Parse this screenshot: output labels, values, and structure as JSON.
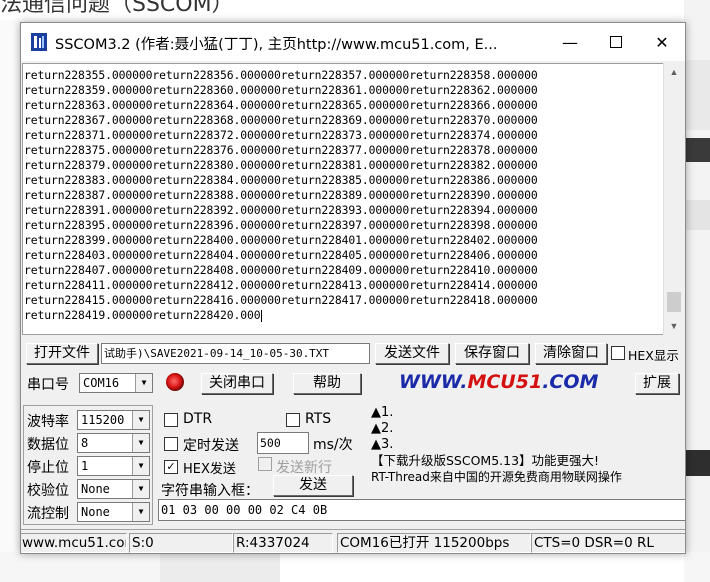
{
  "background": {
    "heading": "法通信问题（SSCOM）"
  },
  "window": {
    "title": "SSCOM3.2 (作者:聂小猛(丁丁), 主页http://www.mcu51.com,  E...",
    "minimize_icon": "minimize-icon",
    "maximize_icon": "maximize-icon",
    "close_icon": "close-icon"
  },
  "receive_area": {
    "lines": [
      "return228355.000000return228356.000000return228357.000000return228358.000000",
      "return228359.000000return228360.000000return228361.000000return228362.000000",
      "return228363.000000return228364.000000return228365.000000return228366.000000",
      "return228367.000000return228368.000000return228369.000000return228370.000000",
      "return228371.000000return228372.000000return228373.000000return228374.000000",
      "return228375.000000return228376.000000return228377.000000return228378.000000",
      "return228379.000000return228380.000000return228381.000000return228382.000000",
      "return228383.000000return228384.000000return228385.000000return228386.000000",
      "return228387.000000return228388.000000return228389.000000return228390.000000",
      "return228391.000000return228392.000000return228393.000000return228394.000000",
      "return228395.000000return228396.000000return228397.000000return228398.000000",
      "return228399.000000return228400.000000return228401.000000return228402.000000",
      "return228403.000000return228404.000000return228405.000000return228406.000000",
      "return228407.000000return228408.000000return228409.000000return228410.000000",
      "return228411.000000return228412.000000return228413.000000return228414.000000",
      "return228415.000000return228416.000000return228417.000000return228418.000000",
      "return228419.000000return228420.000"
    ]
  },
  "toolbar1": {
    "open_file": "打开文件",
    "file_path": "试助手)\\SAVE2021-09-14_10-05-30.TXT",
    "send_file": "发送文件",
    "save_window": "保存窗口",
    "clear_window": "清除窗口",
    "hex_display": "HEX显示"
  },
  "toolbar2": {
    "port_label": "串口号",
    "port_value": "COM16",
    "close_port": "关闭串口",
    "help": "帮助",
    "brand_prefix": "WWW.",
    "brand_mid": "MCU51",
    "brand_suffix": ".COM",
    "expand": "扩展"
  },
  "serial_settings": {
    "baud_label": "波特率",
    "baud_value": "115200",
    "databits_label": "数据位",
    "databits_value": "8",
    "stopbits_label": "停止位",
    "stopbits_value": "1",
    "parity_label": "校验位",
    "parity_value": "None",
    "flow_label": "流控制",
    "flow_value": "None"
  },
  "send_options": {
    "dtr": "DTR",
    "rts": "RTS",
    "timed_send": "定时发送",
    "interval_value": "500",
    "interval_unit": "ms/次",
    "hex_send": "HEX发送",
    "hex_send_checked": "✓",
    "send_newline": "发送新行",
    "input_label": "字符串输入框：",
    "send_button": "发送",
    "send_value": "01 03 00 00 00 02 C4 0B"
  },
  "notice": {
    "line1": "▲1.",
    "line2": "▲2.",
    "line3": "▲3.",
    "line4": "【下载升级版SSCOM5.13】功能更强大!",
    "line5": "RT-Thread来自中国的开源免费商用物联网操作"
  },
  "status_bar": {
    "site": "www.mcu51.com",
    "sent": "S:0",
    "received": "R:4337024",
    "port_status": "COM16已打开  115200bps",
    "lines": "CTS=0 DSR=0 RL"
  },
  "colors": {
    "brand_blue": "#1a2aa8",
    "brand_red": "#d41010"
  }
}
